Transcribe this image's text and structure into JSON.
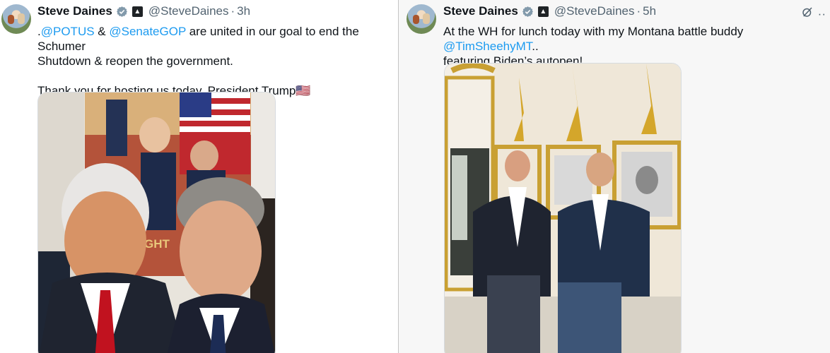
{
  "left_tweet": {
    "author_name": "Steve Daines",
    "handle": "@SteveDaines",
    "separator": "·",
    "time": "3h",
    "line1_prefix": ".",
    "mention_potus": "@POTUS",
    "amp": " & ",
    "mention_senategop": "@SenateGOP",
    "line1_suffix": " are united in our goal to end the Schumer",
    "line2": "Shutdown & reopen the government.",
    "line3": "Thank you for hosting us today, President Trump",
    "flag_emoji": "🇺🇸",
    "media_text": "GHT"
  },
  "right_tweet": {
    "author_name": "Steve Daines",
    "handle": "@SteveDaines",
    "separator": "·",
    "time": "5h",
    "line1_prefix": "At the WH for lunch today with my Montana battle buddy ",
    "mention_sheehy": "@TimSheehyMT",
    "line1_suffix": "..",
    "line2": "featuring Biden’s autopen!",
    "more_glyph": "··"
  },
  "colors": {
    "link": "#1d9bf0",
    "secondary": "#536471",
    "verified": "#829aab"
  },
  "icons": [
    "verified-badge-icon",
    "government-badge-icon",
    "grok-icon",
    "more-options-icon"
  ]
}
